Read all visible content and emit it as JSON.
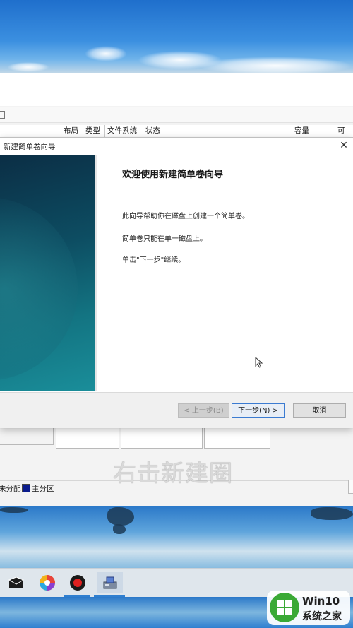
{
  "disk_management": {
    "columns": [
      "布局",
      "类型",
      "文件系统",
      "状态",
      "容量",
      "可"
    ],
    "legend": {
      "unallocated": "未分配",
      "primary_partition": "主分区"
    }
  },
  "wizard": {
    "title": "新建简单卷向导",
    "heading": "欢迎使用新建简单卷向导",
    "paragraph1": "此向导帮助你在磁盘上创建一个简单卷。",
    "paragraph2": "简单卷只能在单一磁盘上。",
    "paragraph3": "单击\"下一步\"继续。",
    "back_label": "< 上一步(B)",
    "next_label": "下一步(N) >",
    "cancel_label": "取消"
  },
  "subtitle": "右击新建圈",
  "taskbar": {
    "icons": [
      "mail-icon",
      "color-wheel-icon",
      "record-icon",
      "disk-management-icon"
    ]
  },
  "watermark": {
    "line1": "Win10",
    "line2": "系统之家"
  },
  "colors": {
    "primary_partition": "#0a1b8c",
    "next_button_border": "#3b7bd1"
  }
}
